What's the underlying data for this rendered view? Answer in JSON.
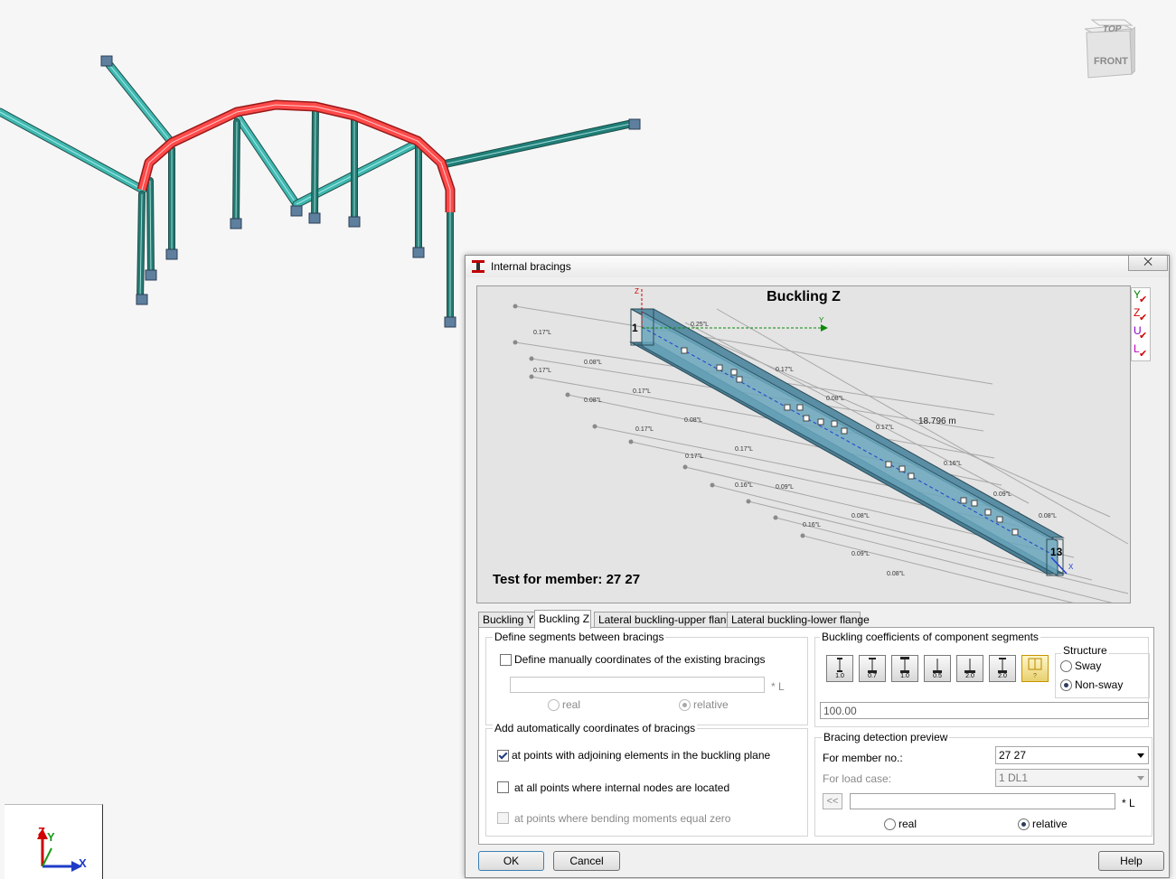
{
  "viewport": {
    "navcube": {
      "top_label": "TOP",
      "front_label": "FRONT"
    },
    "axes": {
      "z": "Z",
      "y": "Y",
      "x": "X"
    }
  },
  "dialog": {
    "title": "Internal bracings",
    "close_label": "⨉",
    "preview": {
      "title": "Buckling Z",
      "test_text": "Test for member: 27 27",
      "length_label": "18.796  m",
      "node_start": "1",
      "node_end": "13",
      "axis_z": "Z",
      "axis_y": "Y",
      "axis_x": "X",
      "left_dim_labels": [
        "0.17\"L",
        "0.17\"L",
        "0.08\"L",
        "0.08\"L",
        "0.17\"L",
        "0.17\"L",
        "0.08\"L",
        "0.17\"L",
        "0.17\"L",
        "0.16\"L",
        "0.09\"L",
        "0.16\"L",
        "0.08\"L",
        "0.09\"L",
        "0.08\"L"
      ],
      "right_dim_labels": [
        "0.25\"L",
        "0.17\"L",
        "0.08\"L",
        "0.17\"L",
        "0.16\"L",
        "0.09\"L",
        "0.08\"L"
      ],
      "legend": [
        "Y",
        "Z",
        "U",
        "L"
      ],
      "legend_colors": [
        "#008000",
        "#d00000",
        "#8b00c8",
        "#c000c0"
      ]
    },
    "tabs": [
      "Buckling Y",
      "Buckling Z",
      "Lateral buckling-upper flange",
      "Lateral buckling-lower flange"
    ],
    "active_tab": "Buckling Z",
    "segments": {
      "title": "Define segments between bracings",
      "manual_label": "Define manually coordinates of the existing bracings",
      "manual_checked": false,
      "coords_value": "",
      "unit": "* L",
      "real_label": "real",
      "relative_label": "relative"
    },
    "auto": {
      "title": "Add automatically coordinates of bracings",
      "options": [
        {
          "label": "at points with adjoining elements in the buckling plane",
          "checked": true
        },
        {
          "label": "at all points where internal nodes are located",
          "checked": false
        },
        {
          "label": "at points where bending moments equal zero",
          "checked": false
        }
      ]
    },
    "coefficients": {
      "title": "Buckling coefficients of component segments",
      "buttons": [
        "1.0",
        "0.7",
        "1.0",
        "0.5",
        "2.0",
        "2.0",
        "?"
      ],
      "value": "100.00"
    },
    "structure": {
      "title": "Structure",
      "sway_label": "Sway",
      "nonsway_label": "Non-sway",
      "selected": "Non-sway"
    },
    "detection": {
      "title": "Bracing detection preview",
      "member_label": "For member no.:",
      "member_value": "27  27",
      "loadcase_label": "For load case:",
      "loadcase_value": "1  DL1",
      "nav_label": "<<",
      "coords_value": "",
      "unit": "* L",
      "real_label": "real",
      "relative_label": "relative"
    },
    "buttons": {
      "ok": "OK",
      "cancel": "Cancel",
      "help": "Help"
    }
  }
}
